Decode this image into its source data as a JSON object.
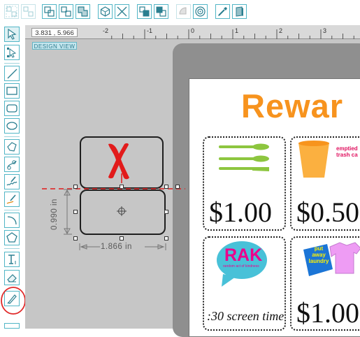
{
  "toolbar": {
    "buttons": [
      {
        "name": "group-icon",
        "state": "disabled"
      },
      {
        "name": "ungroup-icon",
        "state": "disabled"
      },
      {
        "name": "attach-icon",
        "state": "enabled"
      },
      {
        "name": "detach-icon",
        "state": "enabled"
      },
      {
        "name": "weld-icon",
        "state": "enabled"
      },
      {
        "name": "make-compound-icon",
        "state": "enabled"
      },
      {
        "name": "release-compound-icon",
        "state": "enabled"
      },
      {
        "name": "bring-forward-icon",
        "state": "enabled"
      },
      {
        "name": "send-backward-icon",
        "state": "enabled"
      },
      {
        "name": "shadow-icon",
        "state": "disabled"
      },
      {
        "name": "offset-icon",
        "state": "enabled"
      },
      {
        "name": "trace-icon",
        "state": "enabled"
      },
      {
        "name": "3d-icon",
        "state": "enabled"
      }
    ]
  },
  "left_tools": [
    "select-tool-icon",
    "edit-points-icon",
    "line-tool-icon",
    "rectangle-tool-icon",
    "rounded-rectangle-tool-icon",
    "ellipse-tool-icon",
    "polygon-tool-icon",
    "bezier-tool-icon",
    "freehand-tool-icon",
    "smooth-freehand-tool-icon",
    "arc-tool-icon",
    "regular-polygon-tool-icon",
    "text-tool-icon",
    "eraser-tool-icon",
    "knife-tool-icon"
  ],
  "ruler": {
    "coordinates": "3.831 , 5.966",
    "ticks": [
      "-2",
      "-1",
      "0",
      "1",
      "2",
      "3"
    ]
  },
  "canvas": {
    "view_label": "DESIGN VIEW",
    "page_title": "Rewar",
    "cards": [
      {
        "price": "$1.00",
        "icon": "utensils-icon"
      },
      {
        "price": "$0.50",
        "icon": "cup-icon",
        "label_line1": "emptied",
        "label_line2": "trash ca"
      },
      {
        "price": ":30 screen time",
        "icon": "rak-speech-bubble-icon",
        "badge": "RAK",
        "badge_sub": "random act of kindness"
      },
      {
        "price": "$1.00",
        "icon": "laundry-shirt-icon",
        "tag_line1": "put",
        "tag_line2": "away",
        "tag_line3": "laundry"
      }
    ],
    "selection": {
      "mark": "X",
      "width_label": "1.866 in",
      "height_label": "0.990 in"
    }
  },
  "colors": {
    "accent": "#52b6c6",
    "title_orange": "#f7931e",
    "cut_line_red": "#e21b1b",
    "annotation_red": "#e02a2a"
  }
}
